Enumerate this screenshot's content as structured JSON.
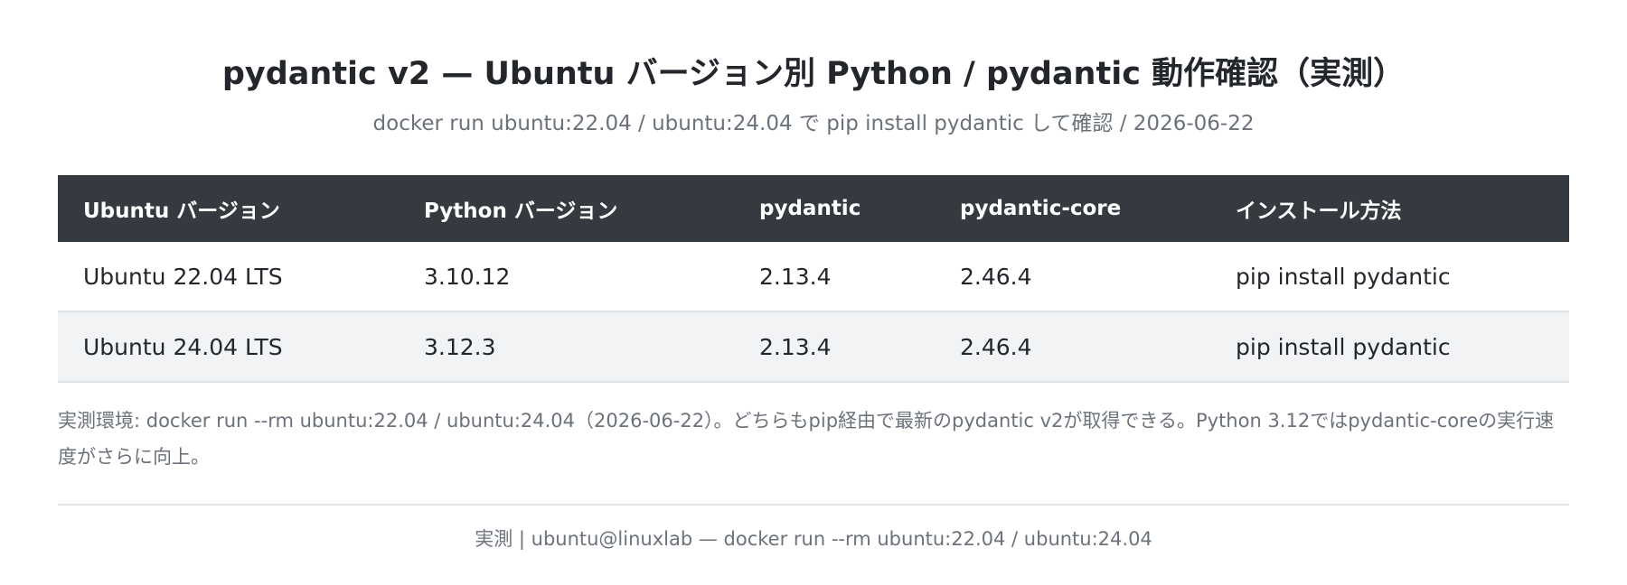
{
  "header": {
    "title": "pydantic v2 — Ubuntu バージョン別 Python / pydantic 動作確認（実測）",
    "subtitle": "docker run ubuntu:22.04 / ubuntu:24.04 で pip install pydantic して確認 / 2026-06-22"
  },
  "table": {
    "columns": [
      "Ubuntu バージョン",
      "Python バージョン",
      "pydantic",
      "pydantic-core",
      "インストール方法"
    ],
    "rows": [
      [
        "Ubuntu 22.04 LTS",
        "3.10.12",
        "2.13.4",
        "2.46.4",
        "pip install pydantic"
      ],
      [
        "Ubuntu 24.04 LTS",
        "3.12.3",
        "2.13.4",
        "2.46.4",
        "pip install pydantic"
      ]
    ]
  },
  "note": "実測環境: docker run --rm ubuntu:22.04 / ubuntu:24.04（2026-06-22）。どちらもpip経由で最新のpydantic v2が取得できる。Python 3.12ではpydantic-coreの実行速度がさらに向上。",
  "footer": "実測 | ubuntu@linuxlab — docker run --rm ubuntu:22.04 / ubuntu:24.04",
  "colors": {
    "header_bg": "#343a40",
    "header_text": "#ffffff",
    "alt_row_bg": "#f2f3f5",
    "muted_text": "#6c727a"
  }
}
